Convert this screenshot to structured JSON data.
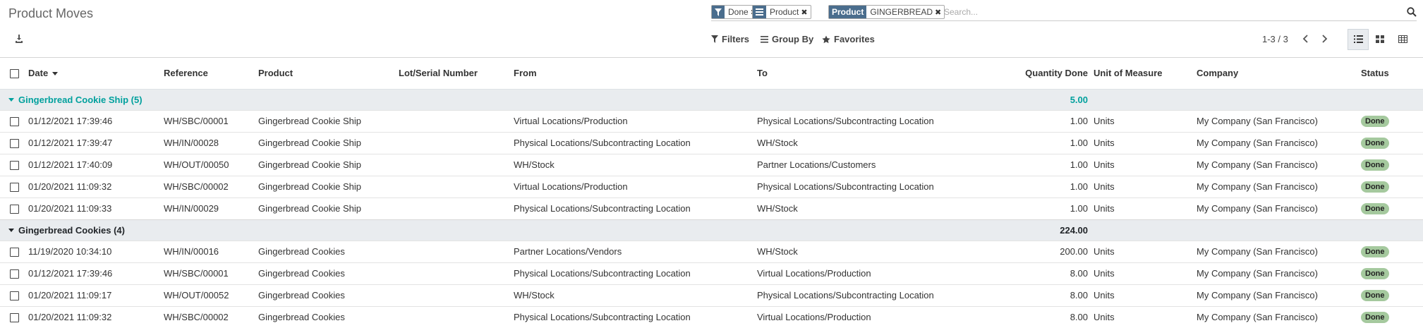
{
  "page": {
    "title": "Product Moves"
  },
  "search": {
    "placeholder": "Search...",
    "facets": [
      {
        "icon": "filter-icon",
        "label": "",
        "value": "Done"
      },
      {
        "icon": "group-by-icon",
        "label": "",
        "value": "Product"
      },
      {
        "icon": "",
        "label": "Product",
        "value": "GINGERBREAD"
      }
    ]
  },
  "toolbar": {
    "filters": "Filters",
    "group_by": "Group By",
    "favorites": "Favorites"
  },
  "pager": {
    "value": "1-3 / 3"
  },
  "columns": {
    "date": "Date",
    "reference": "Reference",
    "product": "Product",
    "lot": "Lot/Serial Number",
    "from": "From",
    "to": "To",
    "qty": "Quantity Done",
    "uom": "Unit of Measure",
    "company": "Company",
    "status": "Status"
  },
  "groups": [
    {
      "label": "Gingerbread Cookie Ship (5)",
      "total": "5.00",
      "color": "#00A09D",
      "rows": [
        {
          "date": "01/12/2021 17:39:46",
          "reference": "WH/SBC/00001",
          "product": "Gingerbread Cookie Ship",
          "lot": "",
          "from": "Virtual Locations/Production",
          "to": "Physical Locations/Subcontracting Location",
          "qty": "1.00",
          "uom": "Units",
          "company": "My Company (San Francisco)",
          "status": "Done"
        },
        {
          "date": "01/12/2021 17:39:47",
          "reference": "WH/IN/00028",
          "product": "Gingerbread Cookie Ship",
          "lot": "",
          "from": "Physical Locations/Subcontracting Location",
          "to": "WH/Stock",
          "qty": "1.00",
          "uom": "Units",
          "company": "My Company (San Francisco)",
          "status": "Done"
        },
        {
          "date": "01/12/2021 17:40:09",
          "reference": "WH/OUT/00050",
          "product": "Gingerbread Cookie Ship",
          "lot": "",
          "from": "WH/Stock",
          "to": "Partner Locations/Customers",
          "qty": "1.00",
          "uom": "Units",
          "company": "My Company (San Francisco)",
          "status": "Done"
        },
        {
          "date": "01/20/2021 11:09:32",
          "reference": "WH/SBC/00002",
          "product": "Gingerbread Cookie Ship",
          "lot": "",
          "from": "Virtual Locations/Production",
          "to": "Physical Locations/Subcontracting Location",
          "qty": "1.00",
          "uom": "Units",
          "company": "My Company (San Francisco)",
          "status": "Done"
        },
        {
          "date": "01/20/2021 11:09:33",
          "reference": "WH/IN/00029",
          "product": "Gingerbread Cookie Ship",
          "lot": "",
          "from": "Physical Locations/Subcontracting Location",
          "to": "WH/Stock",
          "qty": "1.00",
          "uom": "Units",
          "company": "My Company (San Francisco)",
          "status": "Done"
        }
      ]
    },
    {
      "label": "Gingerbread Cookies (4)",
      "total": "224.00",
      "color": "#212529",
      "rows": [
        {
          "date": "11/19/2020 10:34:10",
          "reference": "WH/IN/00016",
          "product": "Gingerbread Cookies",
          "lot": "",
          "from": "Partner Locations/Vendors",
          "to": "WH/Stock",
          "qty": "200.00",
          "uom": "Units",
          "company": "My Company (San Francisco)",
          "status": "Done"
        },
        {
          "date": "01/12/2021 17:39:46",
          "reference": "WH/SBC/00001",
          "product": "Gingerbread Cookies",
          "lot": "",
          "from": "Physical Locations/Subcontracting Location",
          "to": "Virtual Locations/Production",
          "qty": "8.00",
          "uom": "Units",
          "company": "My Company (San Francisco)",
          "status": "Done"
        },
        {
          "date": "01/20/2021 11:09:17",
          "reference": "WH/OUT/00052",
          "product": "Gingerbread Cookies",
          "lot": "",
          "from": "WH/Stock",
          "to": "Physical Locations/Subcontracting Location",
          "qty": "8.00",
          "uom": "Units",
          "company": "My Company (San Francisco)",
          "status": "Done"
        },
        {
          "date": "01/20/2021 11:09:32",
          "reference": "WH/SBC/00002",
          "product": "Gingerbread Cookies",
          "lot": "",
          "from": "Physical Locations/Subcontracting Location",
          "to": "Virtual Locations/Production",
          "qty": "8.00",
          "uom": "Units",
          "company": "My Company (San Francisco)",
          "status": "Done"
        }
      ]
    }
  ],
  "colors": {
    "facet_icon_bg": "#4A6D8D",
    "done_badge": "#A5C99E",
    "group_bg": "#E9ECEF"
  }
}
